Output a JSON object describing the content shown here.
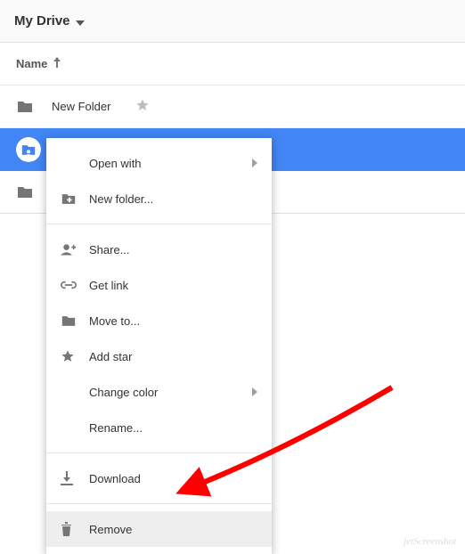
{
  "header": {
    "title": "My Drive"
  },
  "listHeader": {
    "name_label": "Name"
  },
  "rows": [
    {
      "name": "New Folder",
      "starred": true
    },
    {
      "name": "",
      "starred": false
    },
    {
      "name": "",
      "starred": false
    }
  ],
  "contextMenu": {
    "open_with": "Open with",
    "new_folder": "New folder...",
    "share": "Share...",
    "get_link": "Get link",
    "move_to": "Move to...",
    "add_star": "Add star",
    "change_color": "Change color",
    "rename": "Rename...",
    "download": "Download",
    "remove": "Remove"
  },
  "watermark": "jetScreenshot"
}
